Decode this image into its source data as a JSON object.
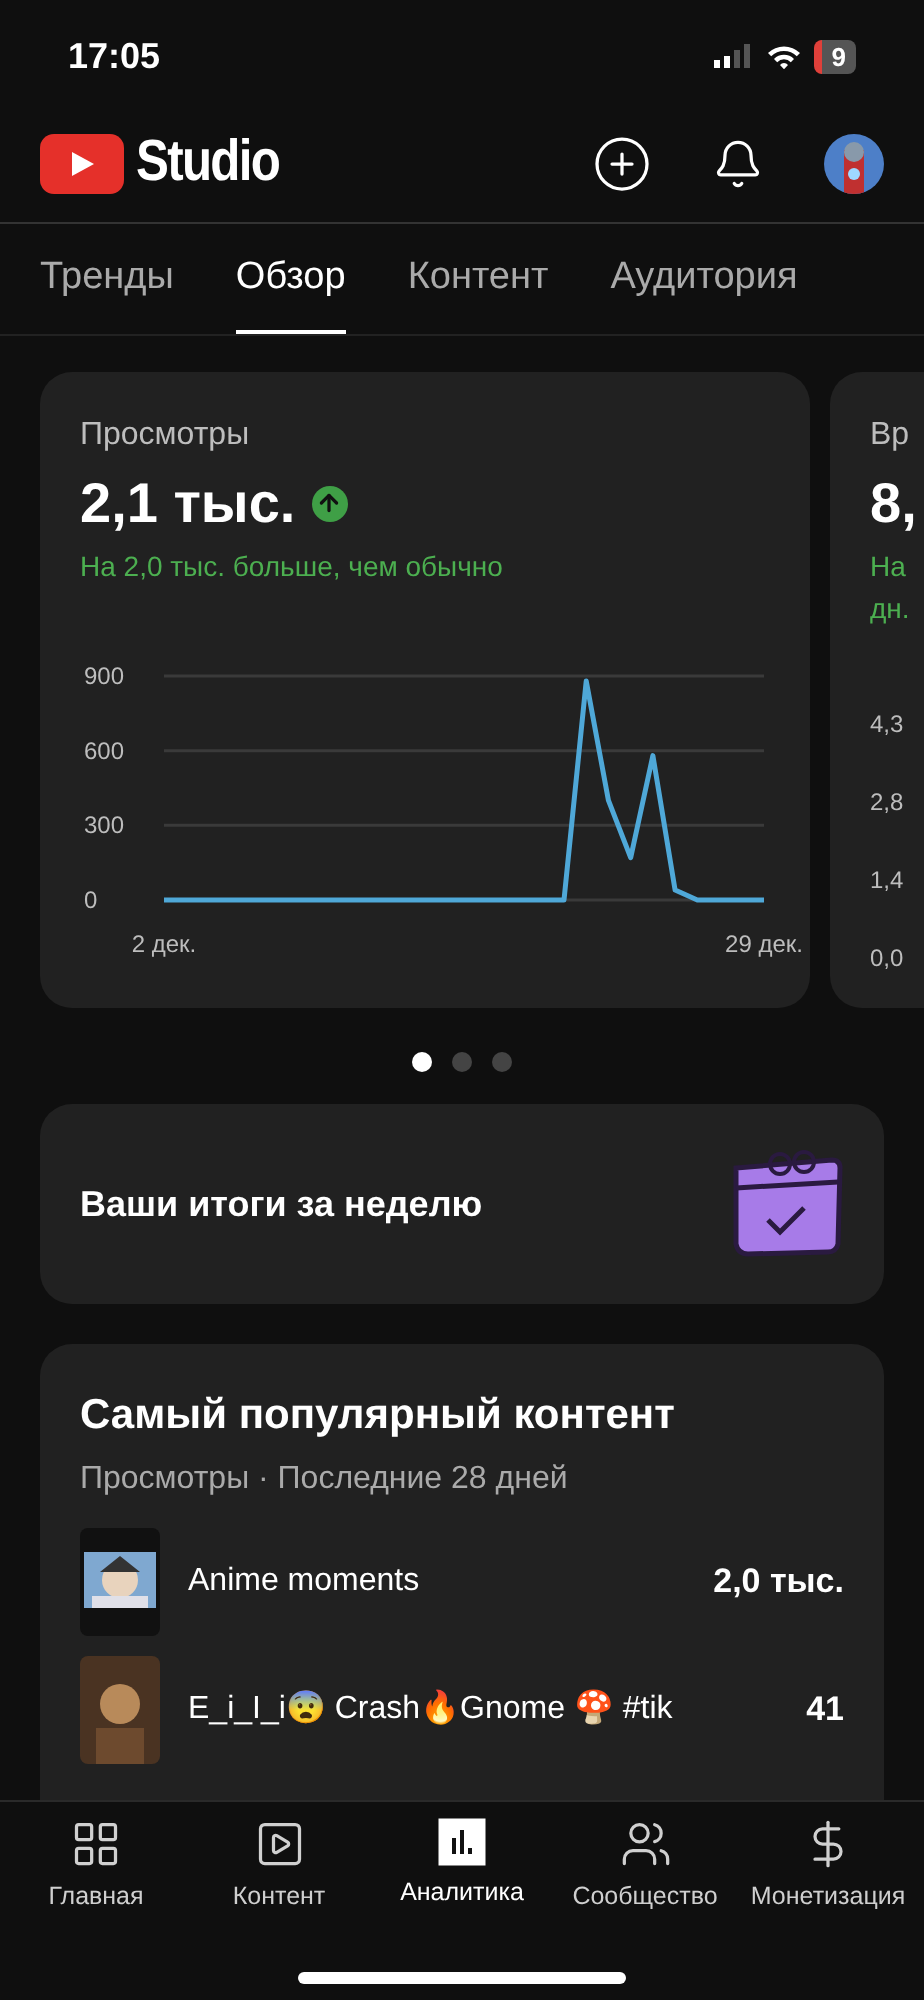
{
  "status_bar": {
    "time": "17:05",
    "battery": "9"
  },
  "header": {
    "logo_text": "Studio"
  },
  "tabs": [
    {
      "label": "Тренды",
      "selected": false
    },
    {
      "label": "Обзор",
      "selected": true
    },
    {
      "label": "Контент",
      "selected": false
    },
    {
      "label": "Аудитория",
      "selected": false
    }
  ],
  "cards": [
    {
      "title": "Просмотры",
      "value": "2,1 тыс.",
      "rising": true,
      "note": "На 2,0 тыс. больше, чем обычно",
      "chart_data": {
        "type": "line",
        "x": [
          2,
          3,
          4,
          5,
          6,
          7,
          8,
          9,
          10,
          11,
          12,
          13,
          14,
          15,
          16,
          17,
          18,
          19,
          20,
          21,
          22,
          23,
          24,
          25,
          26,
          27,
          28,
          29
        ],
        "series": [
          {
            "color": "#4fa8d8",
            "values": [
              0,
              0,
              0,
              0,
              0,
              0,
              0,
              0,
              0,
              0,
              0,
              0,
              0,
              0,
              0,
              0,
              0,
              0,
              0,
              880,
              400,
              170,
              580,
              40,
              0,
              0,
              0,
              0
            ]
          }
        ],
        "xlim": [
          2,
          29
        ],
        "ylim": [
          0,
          900
        ],
        "yticks": [
          0,
          300,
          600,
          900
        ],
        "xticks": [
          {
            "value": 2,
            "label": "2 дек."
          },
          {
            "value": 29,
            "label": "29 дек."
          }
        ]
      }
    },
    {
      "title": "Вр",
      "value": "8,",
      "note": "На",
      "note_2": "дн.",
      "axis_labels": [
        "4,3",
        "2,8",
        "1,4",
        "0,0"
      ]
    }
  ],
  "carousel_dots": [
    {
      "selected": true
    },
    {
      "selected": false
    },
    {
      "selected": false
    }
  ],
  "weekly_card": {
    "title": "Ваши итоги за неделю"
  },
  "popular": {
    "title": "Самый популярный контент",
    "subtitle": "Просмотры · Последние 28 дней",
    "rows": [
      {
        "title": "Anime moments",
        "views": "2,0 тыс."
      },
      {
        "title": "E_i_I_i😨 Crash🔥Gnome 🍄 #tik",
        "views": "41"
      }
    ]
  },
  "nav": [
    {
      "label": "Главная",
      "selected": false
    },
    {
      "label": "Контент",
      "selected": false
    },
    {
      "label": "Аналитика",
      "selected": true
    },
    {
      "label": "Сообщество",
      "selected": false
    },
    {
      "label": "Монетизация",
      "selected": false
    }
  ]
}
